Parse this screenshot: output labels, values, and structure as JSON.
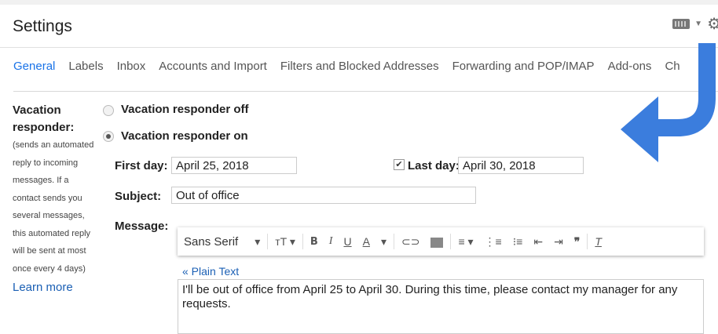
{
  "header": {
    "title": "Settings"
  },
  "tabs": [
    {
      "label": "General",
      "active": true
    },
    {
      "label": "Labels"
    },
    {
      "label": "Inbox"
    },
    {
      "label": "Accounts and Import"
    },
    {
      "label": "Filters and Blocked Addresses"
    },
    {
      "label": "Forwarding and POP/IMAP"
    },
    {
      "label": "Add-ons"
    },
    {
      "label": "Ch"
    }
  ],
  "sidebar": {
    "heading": "Vacation responder:",
    "description_lines": [
      "(sends an automated",
      "reply to incoming",
      "messages. If a",
      "contact sends you",
      "several messages,",
      "this automated reply",
      "will be sent at most",
      "once every 4 days)"
    ],
    "learn_more": "Learn more"
  },
  "responder": {
    "off_label": "Vacation responder off",
    "on_label": "Vacation responder on",
    "selected": "on"
  },
  "form": {
    "first_day_label": "First day:",
    "first_day_value": "April 25, 2018",
    "last_day_label": "Last day:",
    "last_day_value": "April 30, 2018",
    "last_day_checked": true,
    "subject_label": "Subject:",
    "subject_value": "Out of office",
    "message_label": "Message:"
  },
  "toolbar": {
    "font": "Sans Serif",
    "bold": "B",
    "italic": "I",
    "underline": "U",
    "text_color": "A",
    "remove_format": "T"
  },
  "editor": {
    "plain_text_link": "« Plain Text",
    "message_text": "I'll be out of office from April 25 to April 30. During this time, please contact my manager for any requests."
  },
  "colors": {
    "accent": "#1a73e8",
    "arrow": "#3b7ddd"
  }
}
